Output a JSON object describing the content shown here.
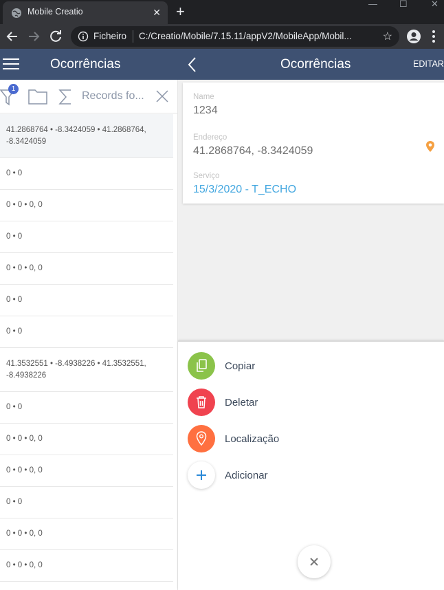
{
  "browser": {
    "tab_title": "Mobile Creatio",
    "tab_close": "✕",
    "new_tab": "+",
    "scheme_label": "Ficheiro",
    "url": "C:/Creatio/Mobile/7.15.11/appV2/MobileApp/Mobil...",
    "minimize": "—",
    "maximize": "☐",
    "close": "✕",
    "star": "☆"
  },
  "header": {
    "left_title": "Ocorrências",
    "right_title": "Ocorrências",
    "edit_label": "EDITAR",
    "bg_color": "#3e5172"
  },
  "filter_bar": {
    "filter_badge": "1",
    "search_text": "Records fo..."
  },
  "list": [
    {
      "lines": [
        "41.2868764 • -8.3424059 • 41.2868764,",
        "-8.3424059"
      ],
      "selected": true
    },
    {
      "lines": [
        "0 • 0"
      ]
    },
    {
      "lines": [
        "0 • 0 • 0, 0"
      ]
    },
    {
      "lines": [
        "0 • 0"
      ]
    },
    {
      "lines": [
        "0 • 0 • 0, 0"
      ]
    },
    {
      "lines": [
        "0 • 0"
      ]
    },
    {
      "lines": [
        "0 • 0"
      ]
    },
    {
      "lines": [
        "41.3532551 • -8.4938226 • 41.3532551,",
        "-8.4938226"
      ]
    },
    {
      "lines": [
        "0 • 0"
      ]
    },
    {
      "lines": [
        "0 • 0 • 0, 0"
      ]
    },
    {
      "lines": [
        "0 • 0 • 0, 0"
      ]
    },
    {
      "lines": [
        "0 • 0"
      ]
    },
    {
      "lines": [
        "0 • 0 • 0, 0"
      ]
    },
    {
      "lines": [
        "0 • 0 • 0, 0"
      ]
    }
  ],
  "detail": {
    "name_label": "Name",
    "name_value": "1234",
    "address_label": "Endereço",
    "address_value": "41.2868764, -8.3424059",
    "service_label": "Serviço",
    "service_value": "15/3/2020 - T_ECHO"
  },
  "actions": [
    {
      "label": "Copiar",
      "icon": "copy-icon",
      "color": "#8bc34a"
    },
    {
      "label": "Deletar",
      "icon": "trash-icon",
      "color": "#f0434f"
    },
    {
      "label": "Localização",
      "icon": "location-pin-icon",
      "color": "#ff7040"
    },
    {
      "label": "Adicionar",
      "icon": "plus-icon",
      "color": "#ffffff"
    }
  ],
  "close_sheet": "✕"
}
